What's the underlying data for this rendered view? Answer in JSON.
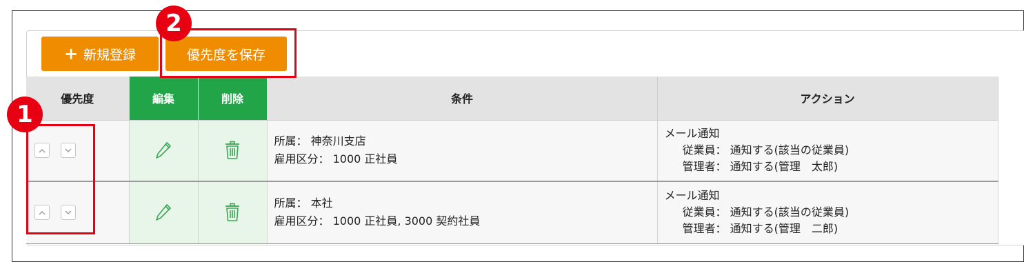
{
  "toolbar": {
    "new_label": "新規登録",
    "save_priority_label": "優先度を保存"
  },
  "callouts": [
    "1",
    "2"
  ],
  "table": {
    "headers": {
      "priority": "優先度",
      "edit": "編集",
      "delete": "削除",
      "condition": "条件",
      "action": "アクション"
    },
    "rows": [
      {
        "condition_line1": "所属： 神奈川支店",
        "condition_line2": "雇用区分： 1000 正社員",
        "action_title": "メール通知",
        "action_employee": "従業員： 通知する(該当の従業員)",
        "action_manager": "管理者： 通知する(管理　太郎)"
      },
      {
        "condition_line1": "所属： 本社",
        "condition_line2": "雇用区分： 1000 正社員, 3000 契約社員",
        "action_title": "メール通知",
        "action_employee": "従業員： 通知する(該当の従業員)",
        "action_manager": "管理者： 通知する(管理　二郎)"
      }
    ]
  },
  "colors": {
    "accent_orange": "#f08c00",
    "header_green": "#22a548",
    "highlight_red": "#e60012"
  }
}
